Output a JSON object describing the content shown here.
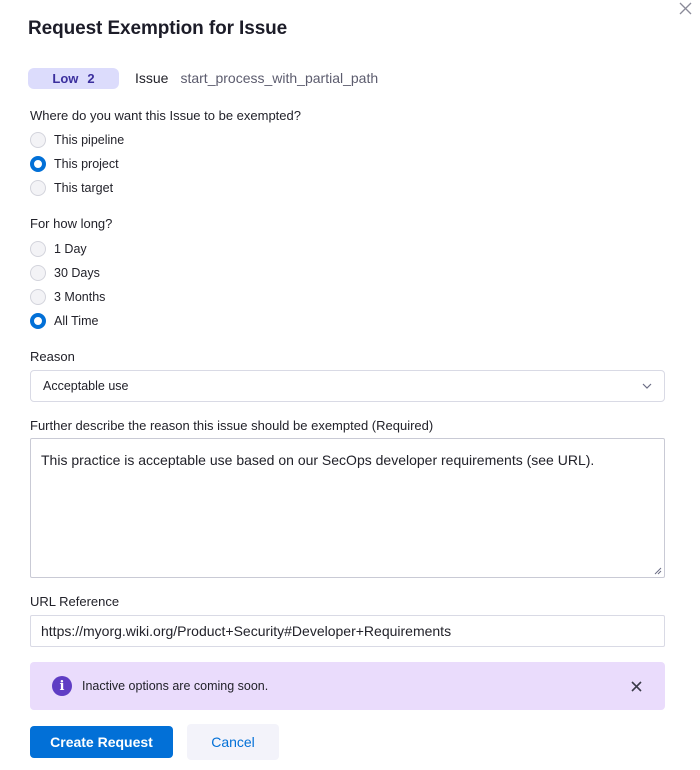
{
  "dialog": {
    "title": "Request Exemption for Issue",
    "close_icon": "close-icon"
  },
  "issue": {
    "severity_label": "Low",
    "severity_count": "2",
    "label": "Issue",
    "name": "start_process_with_partial_path"
  },
  "scope": {
    "question": "Where do you want this Issue to be exempted?",
    "options": [
      {
        "label": "This pipeline",
        "checked": false
      },
      {
        "label": "This project",
        "checked": true
      },
      {
        "label": "This target",
        "checked": false
      }
    ]
  },
  "duration": {
    "question": "For how long?",
    "options": [
      {
        "label": "1 Day",
        "checked": false
      },
      {
        "label": "30 Days",
        "checked": false
      },
      {
        "label": "3 Months",
        "checked": false
      },
      {
        "label": "All Time",
        "checked": true
      }
    ]
  },
  "reason": {
    "label": "Reason",
    "selected": "Acceptable use",
    "icon": "chevron-down-icon"
  },
  "description": {
    "label": "Further describe the reason this issue should be exempted (Required)",
    "value": "This practice is acceptable use based on our SecOps developer requirements (see URL)."
  },
  "url_reference": {
    "label": "URL Reference",
    "value": "https://myorg.wiki.org/Product+Security#Developer+Requirements"
  },
  "callout": {
    "icon": "info-icon",
    "text": "Inactive options are coming soon."
  },
  "actions": {
    "create_label": "Create Request",
    "cancel_label": "Cancel"
  },
  "colors": {
    "primary": "#0270d7",
    "severity_bg": "#dcdcfc",
    "callout_bg": "#eadcfc",
    "info_icon": "#5f3dc4"
  }
}
